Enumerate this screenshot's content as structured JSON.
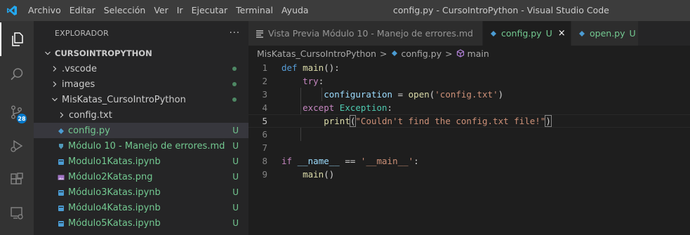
{
  "menu": [
    "Archivo",
    "Editar",
    "Selección",
    "Ver",
    "Ir",
    "Ejecutar",
    "Terminal",
    "Ayuda"
  ],
  "window_title": "config.py - CursoIntroPython - Visual Studio Code",
  "activity": {
    "scm_badge": "28"
  },
  "explorer": {
    "title": "EXPLORADOR",
    "more": "···",
    "root": "CURSOINTROPYTHON",
    "items": [
      {
        "label": ".vscode",
        "status": ""
      },
      {
        "label": "images",
        "status": ""
      },
      {
        "label": "MisKatas_CursoIntroPython",
        "status": ""
      },
      {
        "label": "config.txt",
        "status": ""
      },
      {
        "label": "config.py",
        "status": "U"
      },
      {
        "label": "Módulo 10 - Manejo de errores.md",
        "status": "U"
      },
      {
        "label": "Modulo1Katas.ipynb",
        "status": "U"
      },
      {
        "label": "Módulo2Katas.png",
        "status": "U"
      },
      {
        "label": "Módulo3Katas.ipynb",
        "status": "U"
      },
      {
        "label": "Módulo4Katas.ipynb",
        "status": "U"
      },
      {
        "label": "Módulo5Katas.ipynb",
        "status": "U"
      }
    ]
  },
  "tabs": [
    {
      "label": "Vista Previa Módulo 10 - Manejo de errores.md",
      "modified": ""
    },
    {
      "label": "config.py",
      "modified": "U",
      "close": "×"
    },
    {
      "label": "open.py",
      "modified": "U"
    }
  ],
  "breadcrumb": {
    "folder": "MisKatas_CursoIntroPython",
    "file": "config.py",
    "symbol": "main",
    "sep": ">"
  },
  "code": {
    "line_numbers": [
      "1",
      "2",
      "3",
      "4",
      "5",
      "6",
      "7",
      "8",
      "9"
    ],
    "l1": {
      "kw": "def",
      "fn": "main",
      "rest": "():"
    },
    "l2": {
      "kw": "try",
      "rest": ":"
    },
    "l3": {
      "var": "configuration",
      "op": " = ",
      "fn": "open",
      "p1": "(",
      "str": "'config.txt'",
      "p2": ")"
    },
    "l4": {
      "kw": "except",
      "cls": "Exception",
      "rest": ":"
    },
    "l5": {
      "fn": "print",
      "p1": "(",
      "str": "\"Couldn't find the config.txt file!\"",
      "p2": ")"
    },
    "l8": {
      "kw": "if",
      "var": "__name__",
      "op": " == ",
      "str": "'__main__'",
      "rest": ":"
    },
    "l9": {
      "fn": "main",
      "rest": "()"
    }
  },
  "colors": {
    "accent": "#007acc",
    "untracked": "#73c991"
  }
}
